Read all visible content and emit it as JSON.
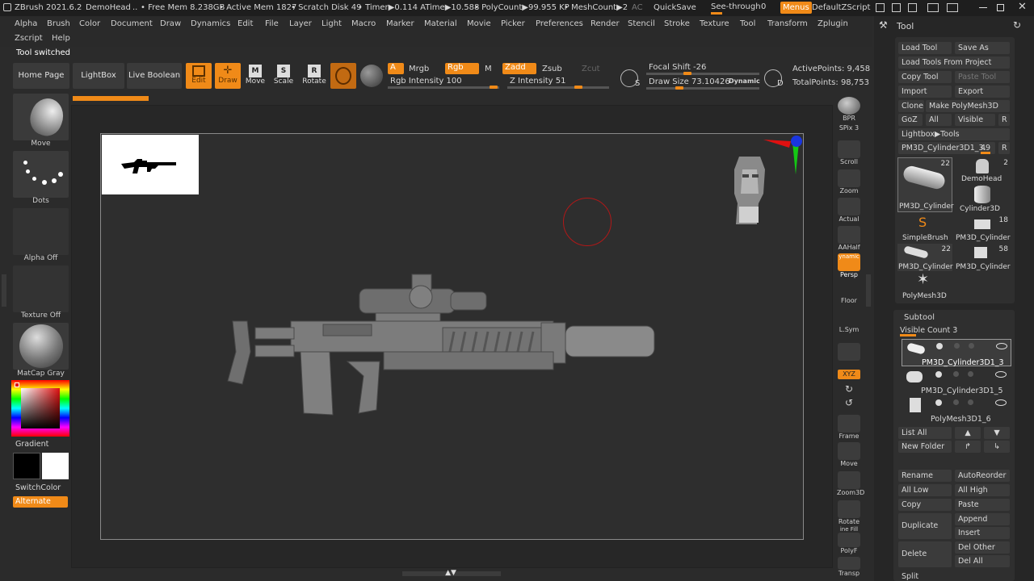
{
  "titlebar": {
    "app": "ZBrush 2021.6.2",
    "project": "DemoHead",
    "dots": "..",
    "free_mem": "• Free Mem 8.238GB",
    "active_mem": "• Active Mem 1827",
    "scratch": "• Scratch Disk 49",
    "timer": "• Timer▶0.114 ATime▶10.588",
    "polycount": "• PolyCount▶99.955 KP",
    "meshcount": "• MeshCount▶2",
    "ac": "AC",
    "quicksave": "QuickSave",
    "see_through_label": "See-through",
    "see_through_value": "0",
    "menus": "Menus",
    "zscript": "DefaultZScript"
  },
  "menubar": {
    "row1": [
      "Alpha",
      "Brush",
      "Color",
      "Document",
      "Draw",
      "Dynamics",
      "Edit",
      "File",
      "Layer",
      "Light",
      "Macro",
      "Marker",
      "Material",
      "Movie",
      "Picker",
      "Preferences",
      "Render",
      "Stencil",
      "Stroke",
      "Texture",
      "Tool",
      "Transform",
      "Zplugin"
    ],
    "row2": [
      "Zscript",
      "Help"
    ]
  },
  "status": "Tool switched",
  "toprow": {
    "home": "Home Page",
    "lightbox": "LightBox",
    "live_boolean": "Live Boolean",
    "edit": "Edit",
    "draw": "Draw",
    "move": "Move",
    "scale": "Scale",
    "rotate": "Rotate",
    "a": "A",
    "mrgb": "Mrgb",
    "rgb": "Rgb",
    "m": "M",
    "rgb_intensity": "Rgb Intensity 100",
    "zadd": "Zadd",
    "zsub": "Zsub",
    "zcut": "Zcut",
    "z_intensity": "Z Intensity 51",
    "focal_shift": "Focal Shift -26",
    "draw_size": "Draw Size 73.10426",
    "dynamic": "Dynamic",
    "active_points": "ActivePoints: 9,458",
    "total_points": "TotalPoints: 98,753"
  },
  "leftshelf": {
    "brush": "Move",
    "stroke": "Dots",
    "alpha": "Alpha Off",
    "texture": "Texture Off",
    "material": "MatCap Gray",
    "gradient": "Gradient",
    "switchcolor": "SwitchColor",
    "alternate": "Alternate"
  },
  "rightshelf": [
    "BPR",
    "SPix 3",
    "Scroll",
    "Zoom",
    "Actual",
    "AAHalf",
    "Persp",
    "Floor",
    "L.Sym",
    "Frame",
    "Move",
    "Zoom3D",
    "Rotate",
    "PolyF",
    "Transp"
  ],
  "rightshelf_extra": {
    "dynamic": "ynamic",
    "xyz": "XYZ",
    "linefill": "ine Fill"
  },
  "toolpanel": {
    "title": "Tool",
    "load_tool": "Load Tool",
    "save_as": "Save As",
    "load_from_project": "Load Tools From Project",
    "copy_tool": "Copy Tool",
    "paste_tool": "Paste Tool",
    "import": "Import",
    "export": "Export",
    "clone": "Clone",
    "make_polymesh": "Make PolyMesh3D",
    "goz": "GoZ",
    "all": "All",
    "visible": "Visible",
    "r": "R",
    "lightbox_tools": "Lightbox▶Tools",
    "current_tool": "PM3D_Cylinder3D1_3.",
    "current_tool_num": "49",
    "thumbs": [
      {
        "label": "PM3D_Cylinder",
        "num": "22"
      },
      {
        "label": "DemoHead",
        "num": "2"
      },
      {
        "label": "Cylinder3D",
        "num": ""
      },
      {
        "label": "SimpleBrush",
        "num": ""
      },
      {
        "label": "PM3D_Cylinder",
        "num": "18"
      },
      {
        "label": "PM3D_Cylinder",
        "num": "22"
      },
      {
        "label": "PM3D_Cylinder",
        "num": "58"
      },
      {
        "label": "PolyMesh3D",
        "num": ""
      }
    ],
    "subtool_title": "Subtool",
    "visible_count": "Visible Count 3",
    "subtools": [
      "PM3D_Cylinder3D1_3",
      "PM3D_Cylinder3D1_5",
      "PolyMesh3D1_6"
    ],
    "list_all": "List All",
    "new_folder": "New Folder",
    "rename": "Rename",
    "autoreorder": "AutoReorder",
    "all_low": "All Low",
    "all_high": "All High",
    "copy": "Copy",
    "paste": "Paste",
    "duplicate": "Duplicate",
    "append": "Append",
    "insert": "Insert",
    "delete": "Delete",
    "del_other": "Del Other",
    "del_all": "Del All",
    "split": "Split"
  },
  "colors": {
    "accent": "#f08a18",
    "panel": "#262626",
    "button": "#3b3b3b"
  }
}
